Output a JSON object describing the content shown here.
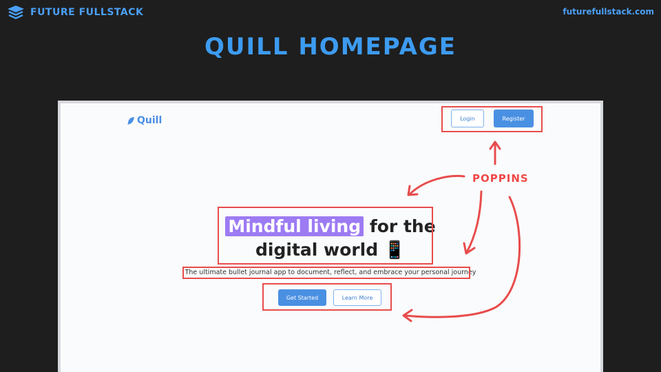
{
  "header": {
    "brand": "FUTURE FULLSTACK",
    "url": "futurefullstack.com",
    "title": "QUILL HOMEPAGE"
  },
  "screenshot": {
    "logo": "Quill",
    "nav": {
      "login": "Login",
      "register": "Register"
    },
    "hero": {
      "highlight": "Mindful living",
      "line1_rest": "for the",
      "line2": "digital world 📱",
      "subtitle": "The ultimate bullet journal app to document, reflect, and embrace your personal journey"
    },
    "cta": {
      "primary": "Get Started",
      "secondary": "Learn More"
    }
  },
  "annotation": {
    "label": "POPPINS",
    "color": "#e84c4c"
  },
  "colors": {
    "accent": "#4a9ff5",
    "highlight": "#9d7bf3",
    "button": "#4a90e2"
  }
}
